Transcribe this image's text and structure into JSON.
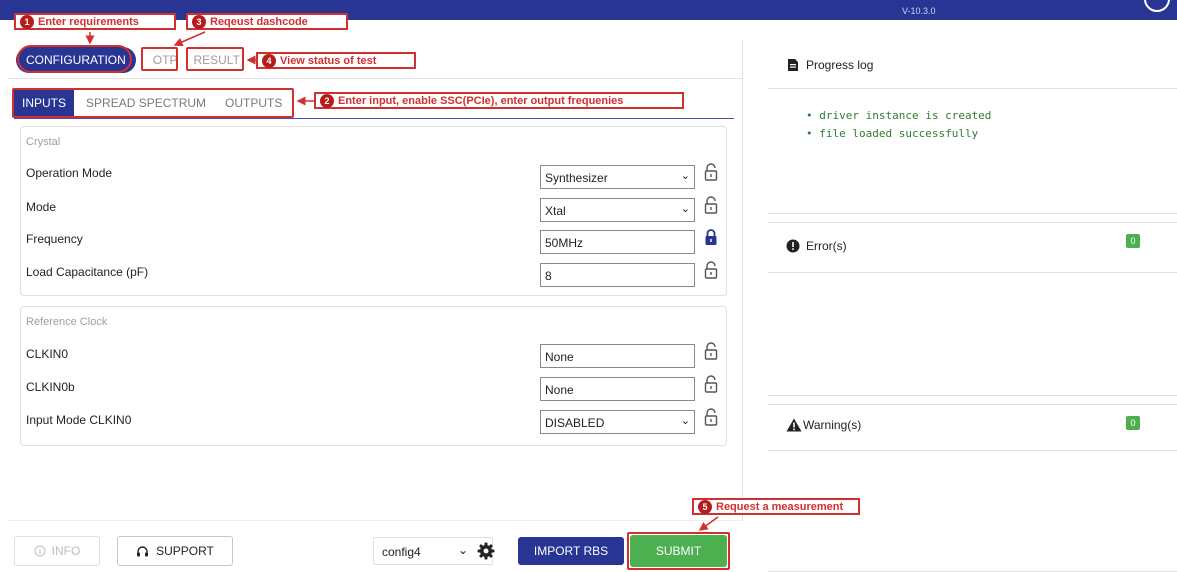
{
  "header": {
    "version": "V-10.3.0"
  },
  "main_tabs": [
    {
      "label": "CONFIGURATION"
    },
    {
      "label": "OTP"
    },
    {
      "label": "RESULT"
    }
  ],
  "sub_tabs": [
    {
      "label": "INPUTS"
    },
    {
      "label": "SPREAD SPECTRUM"
    },
    {
      "label": "OUTPUTS"
    }
  ],
  "crystal": {
    "title": "Crystal",
    "rows": [
      {
        "label": "Operation Mode",
        "value": "Synthesizer",
        "type": "select",
        "locked": false
      },
      {
        "label": "Mode",
        "value": "Xtal",
        "type": "select",
        "locked": false
      },
      {
        "label": "Frequency",
        "value": "50MHz",
        "type": "input",
        "locked": true
      },
      {
        "label": "Load Capacitance (pF)",
        "value": "8",
        "type": "input",
        "locked": false
      }
    ]
  },
  "reference_clock": {
    "title": "Reference Clock",
    "rows": [
      {
        "label": "CLKIN0",
        "value": "None",
        "type": "input",
        "locked": false
      },
      {
        "label": "CLKIN0b",
        "value": "None",
        "type": "input",
        "locked": false
      },
      {
        "label": "Input Mode CLKIN0",
        "value": "DISABLED",
        "type": "select",
        "locked": false
      }
    ]
  },
  "footer": {
    "info_label": "INFO",
    "support_label": "SUPPORT",
    "config_value": "config4",
    "import_label": "IMPORT RBS",
    "submit_label": "SUBMIT"
  },
  "progress_log": {
    "title": "Progress log",
    "lines": [
      "• driver instance is created",
      "• file loaded successfully"
    ]
  },
  "errors": {
    "title": "Error(s)",
    "count": "0"
  },
  "warnings": {
    "title": "Warning(s)",
    "count": "0"
  },
  "annotations": [
    {
      "num": "1",
      "text": "Enter requirements"
    },
    {
      "num": "2",
      "text": "Enter input, enable SSC(PCIe), enter output frequenies"
    },
    {
      "num": "3",
      "text": "Reqeust dashcode"
    },
    {
      "num": "4",
      "text": "View status of test"
    },
    {
      "num": "5",
      "text": "Request a measurement"
    }
  ],
  "colors": {
    "primary": "#283593",
    "success": "#4caf50",
    "annotation": "#d32f2f",
    "log_text": "#2e7d32"
  },
  "icons": [
    "lock-open-icon",
    "lock-closed-icon",
    "gear-icon",
    "headset-icon",
    "info-icon",
    "document-icon",
    "error-icon",
    "warning-icon",
    "chevron-down-icon"
  ]
}
